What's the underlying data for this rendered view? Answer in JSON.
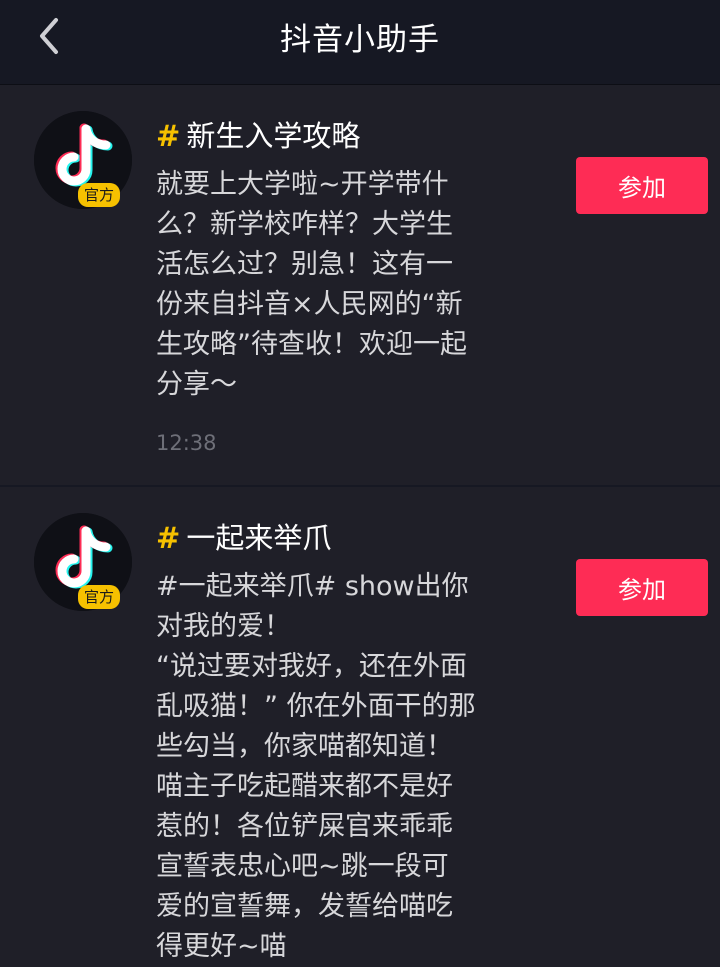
{
  "header": {
    "title": "抖音小助手",
    "back_icon": "chevron-left-icon"
  },
  "colors": {
    "background": "#161823",
    "card": "#1f1f28",
    "accent": "#fe2c55",
    "hashtag": "#f6c100"
  },
  "messages": [
    {
      "avatar_icon": "douyin-logo-icon",
      "badge": "官方",
      "hash": "#",
      "title": "新生入学攻略",
      "description": "就要上大学啦~开学带什\n么？新学校咋样？大学生\n活怎么过？别急！这有一\n份来自抖音×人民网的“新\n生攻略”待查收！欢迎一起\n分享～",
      "time": "12:38",
      "button_label": "参加"
    },
    {
      "avatar_icon": "douyin-logo-icon",
      "badge": "官方",
      "hash": "#",
      "title": "一起来举爪",
      "description": "#一起来举爪# show出你\n对我的爱！\n“说过要对我好，还在外面\n乱吸猫！” 你在外面干的那\n些勾当，你家喵都知道！\n喵主子吃起醋来都不是好\n惹的！各位铲屎官来乖乖\n宣誓表忠心吧~跳一段可\n爱的宣誓舞，发誓给喵吃\n得更好~喵",
      "button_label": "参加"
    }
  ]
}
